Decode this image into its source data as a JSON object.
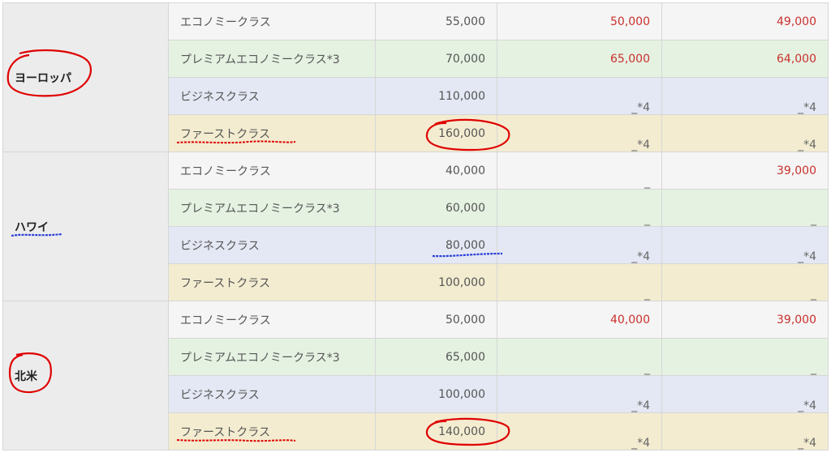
{
  "marks": {
    "first_class_symbol": "_*4",
    "not_available": "_"
  },
  "regions": [
    {
      "name": "ヨーロッパ",
      "annotation": "red-circle",
      "rows": [
        {
          "class": "エコノミークラス",
          "tier": "economy",
          "regular": "55,000",
          "low": "50,000",
          "low_red": true,
          "off": "49,000",
          "off_red": true
        },
        {
          "class": "プレミアムエコノミークラス*3",
          "tier": "premium",
          "regular": "70,000",
          "low": "65,000",
          "low_red": true,
          "off": "64,000",
          "off_red": true
        },
        {
          "class": "ビジネスクラス",
          "tier": "business",
          "regular": "110,000",
          "low": "_*4",
          "low_red": false,
          "off": "_*4",
          "off_red": false
        },
        {
          "class": "ファーストクラス",
          "tier": "first",
          "regular": "160,000",
          "low": "_*4",
          "low_red": false,
          "off": "_*4",
          "off_red": false
        }
      ]
    },
    {
      "name": "ハワイ",
      "annotation": "blue-underline",
      "rows": [
        {
          "class": "エコノミークラス",
          "tier": "economy",
          "regular": "40,000",
          "low": "_",
          "low_red": false,
          "off": "39,000",
          "off_red": true
        },
        {
          "class": "プレミアムエコノミークラス*3",
          "tier": "premium",
          "regular": "60,000",
          "low": "_",
          "low_red": false,
          "off": "_",
          "off_red": false
        },
        {
          "class": "ビジネスクラス",
          "tier": "business",
          "regular": "80,000",
          "low": "_*4",
          "low_red": false,
          "off": "_*4",
          "off_red": false
        },
        {
          "class": "ファーストクラス",
          "tier": "first",
          "regular": "100,000",
          "low": "_",
          "low_red": false,
          "off": "_",
          "off_red": false
        }
      ]
    },
    {
      "name": "北米",
      "annotation": "red-circle",
      "rows": [
        {
          "class": "エコノミークラス",
          "tier": "economy",
          "regular": "50,000",
          "low": "40,000",
          "low_red": true,
          "off": "39,000",
          "off_red": true
        },
        {
          "class": "プレミアムエコノミークラス*3",
          "tier": "premium",
          "regular": "65,000",
          "low": "_",
          "low_red": false,
          "off": "_",
          "off_red": false
        },
        {
          "class": "ビジネスクラス",
          "tier": "business",
          "regular": "100,000",
          "low": "_*4",
          "low_red": false,
          "off": "_*4",
          "off_red": false
        },
        {
          "class": "ファーストクラス",
          "tier": "first",
          "regular": "140,000",
          "low": "_*4",
          "low_red": false,
          "off": "_*4",
          "off_red": false
        }
      ]
    }
  ],
  "colors": {
    "red_value": "#c9302c",
    "annotation_red": "#e00000",
    "annotation_blue": "#2a3fd6"
  }
}
